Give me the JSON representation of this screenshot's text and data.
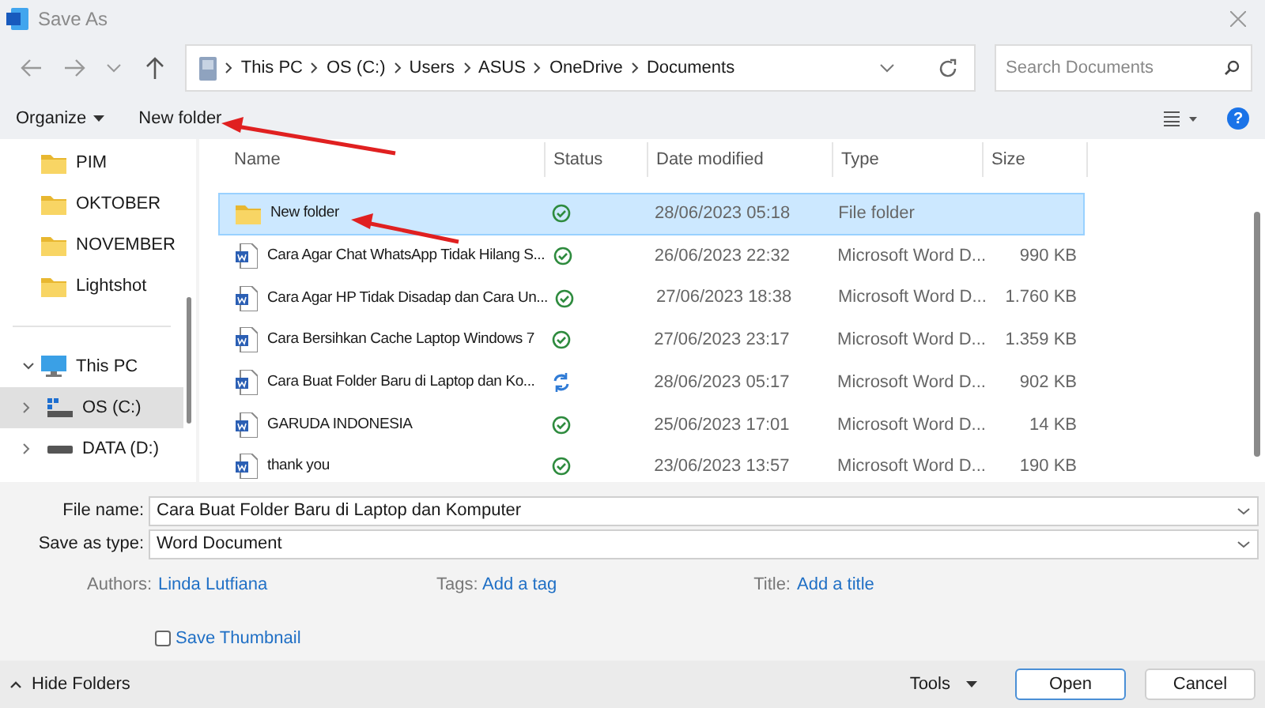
{
  "window": {
    "title": "Save As"
  },
  "nav": {
    "path": [
      "This PC",
      "OS (C:)",
      "Users",
      "ASUS",
      "OneDrive",
      "Documents"
    ],
    "search": {
      "placeholder": "Search Documents"
    }
  },
  "toolbar": {
    "organize": "Organize",
    "new_folder": "New folder",
    "help": "?"
  },
  "sidebar": {
    "items": [
      {
        "label": "PIM",
        "kind": "folder",
        "selected": false
      },
      {
        "label": "OKTOBER",
        "kind": "folder",
        "selected": false
      },
      {
        "label": "NOVEMBER",
        "kind": "folder",
        "selected": false
      },
      {
        "label": "Lightshot",
        "kind": "folder",
        "selected": false
      },
      {
        "label": "This PC",
        "kind": "pc",
        "selected": false,
        "expanded": true,
        "children": [
          {
            "label": "OS (C:)",
            "kind": "drive",
            "selected": true,
            "expanded": false
          },
          {
            "label": "DATA (D:)",
            "kind": "disk",
            "selected": false,
            "expanded": false
          }
        ]
      }
    ]
  },
  "table": {
    "columns": [
      "Name",
      "Status",
      "Date modified",
      "Type",
      "Size"
    ],
    "rows": [
      {
        "kind": "folder",
        "name": "New folder",
        "syncing": false,
        "date": "28/06/2023 05:18",
        "type": "File folder",
        "size": "",
        "selected": true
      },
      {
        "kind": "doc",
        "name": "Cara Agar Chat WhatsApp Tidak Hilang S...",
        "syncing": false,
        "date": "26/06/2023 22:32",
        "type": "Microsoft Word D...",
        "size": "990 KB",
        "selected": false
      },
      {
        "kind": "doc",
        "name": "Cara Agar HP Tidak Disadap dan Cara Un...",
        "syncing": false,
        "date": "27/06/2023 18:38",
        "type": "Microsoft Word D...",
        "size": "1.760 KB",
        "selected": false
      },
      {
        "kind": "doc",
        "name": "Cara Bersihkan Cache Laptop Windows 7",
        "syncing": false,
        "date": "27/06/2023 23:17",
        "type": "Microsoft Word D...",
        "size": "1.359 KB",
        "selected": false
      },
      {
        "kind": "doc",
        "name": "Cara Buat Folder Baru di Laptop dan Ko...",
        "syncing": true,
        "date": "28/06/2023 05:17",
        "type": "Microsoft Word D...",
        "size": "902 KB",
        "selected": false
      },
      {
        "kind": "doc",
        "name": "GARUDA INDONESIA",
        "syncing": false,
        "date": "25/06/2023 17:01",
        "type": "Microsoft Word D...",
        "size": "14 KB",
        "selected": false
      },
      {
        "kind": "doc",
        "name": "thank you",
        "syncing": false,
        "date": "23/06/2023 13:57",
        "type": "Microsoft Word D...",
        "size": "190 KB",
        "selected": false
      }
    ]
  },
  "form": {
    "file_name": {
      "label": "File name:",
      "value": "Cara Buat Folder Baru di Laptop dan Komputer"
    },
    "save_as_type": {
      "label": "Save as type:",
      "value": "Word Document"
    },
    "meta": [
      {
        "label": "Authors:",
        "value": "Linda Lutfiana"
      },
      {
        "label": "Tags:",
        "value": "Add a tag"
      },
      {
        "label": "Title:",
        "value": "Add a title"
      }
    ],
    "save_thumbnail": {
      "label": "Save Thumbnail",
      "checked": false
    }
  },
  "footer": {
    "hide_folders": "Hide Folders",
    "tools": "Tools",
    "buttons": [
      "Open",
      "Cancel"
    ]
  }
}
